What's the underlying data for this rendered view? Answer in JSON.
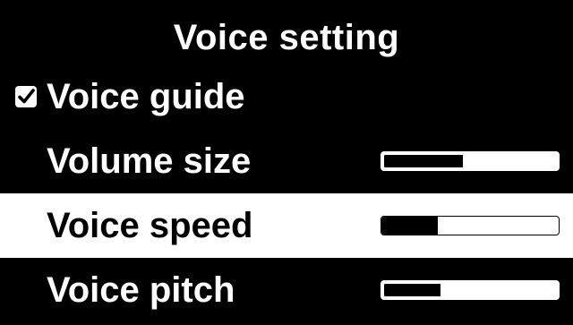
{
  "title": "Voice setting",
  "items": [
    {
      "label": "Voice guide",
      "checked": true
    },
    {
      "label": "Volume size",
      "level": 0.45
    },
    {
      "label": "Voice speed",
      "level": 0.32,
      "selected": true
    },
    {
      "label": "Voice pitch",
      "level": 0.32
    }
  ],
  "colors": {
    "background": "#000000",
    "foreground": "#ffffff",
    "selected_background": "#ffffff",
    "selected_foreground": "#000000"
  },
  "icons": {
    "checkbox": "checkbox-checked-icon"
  }
}
